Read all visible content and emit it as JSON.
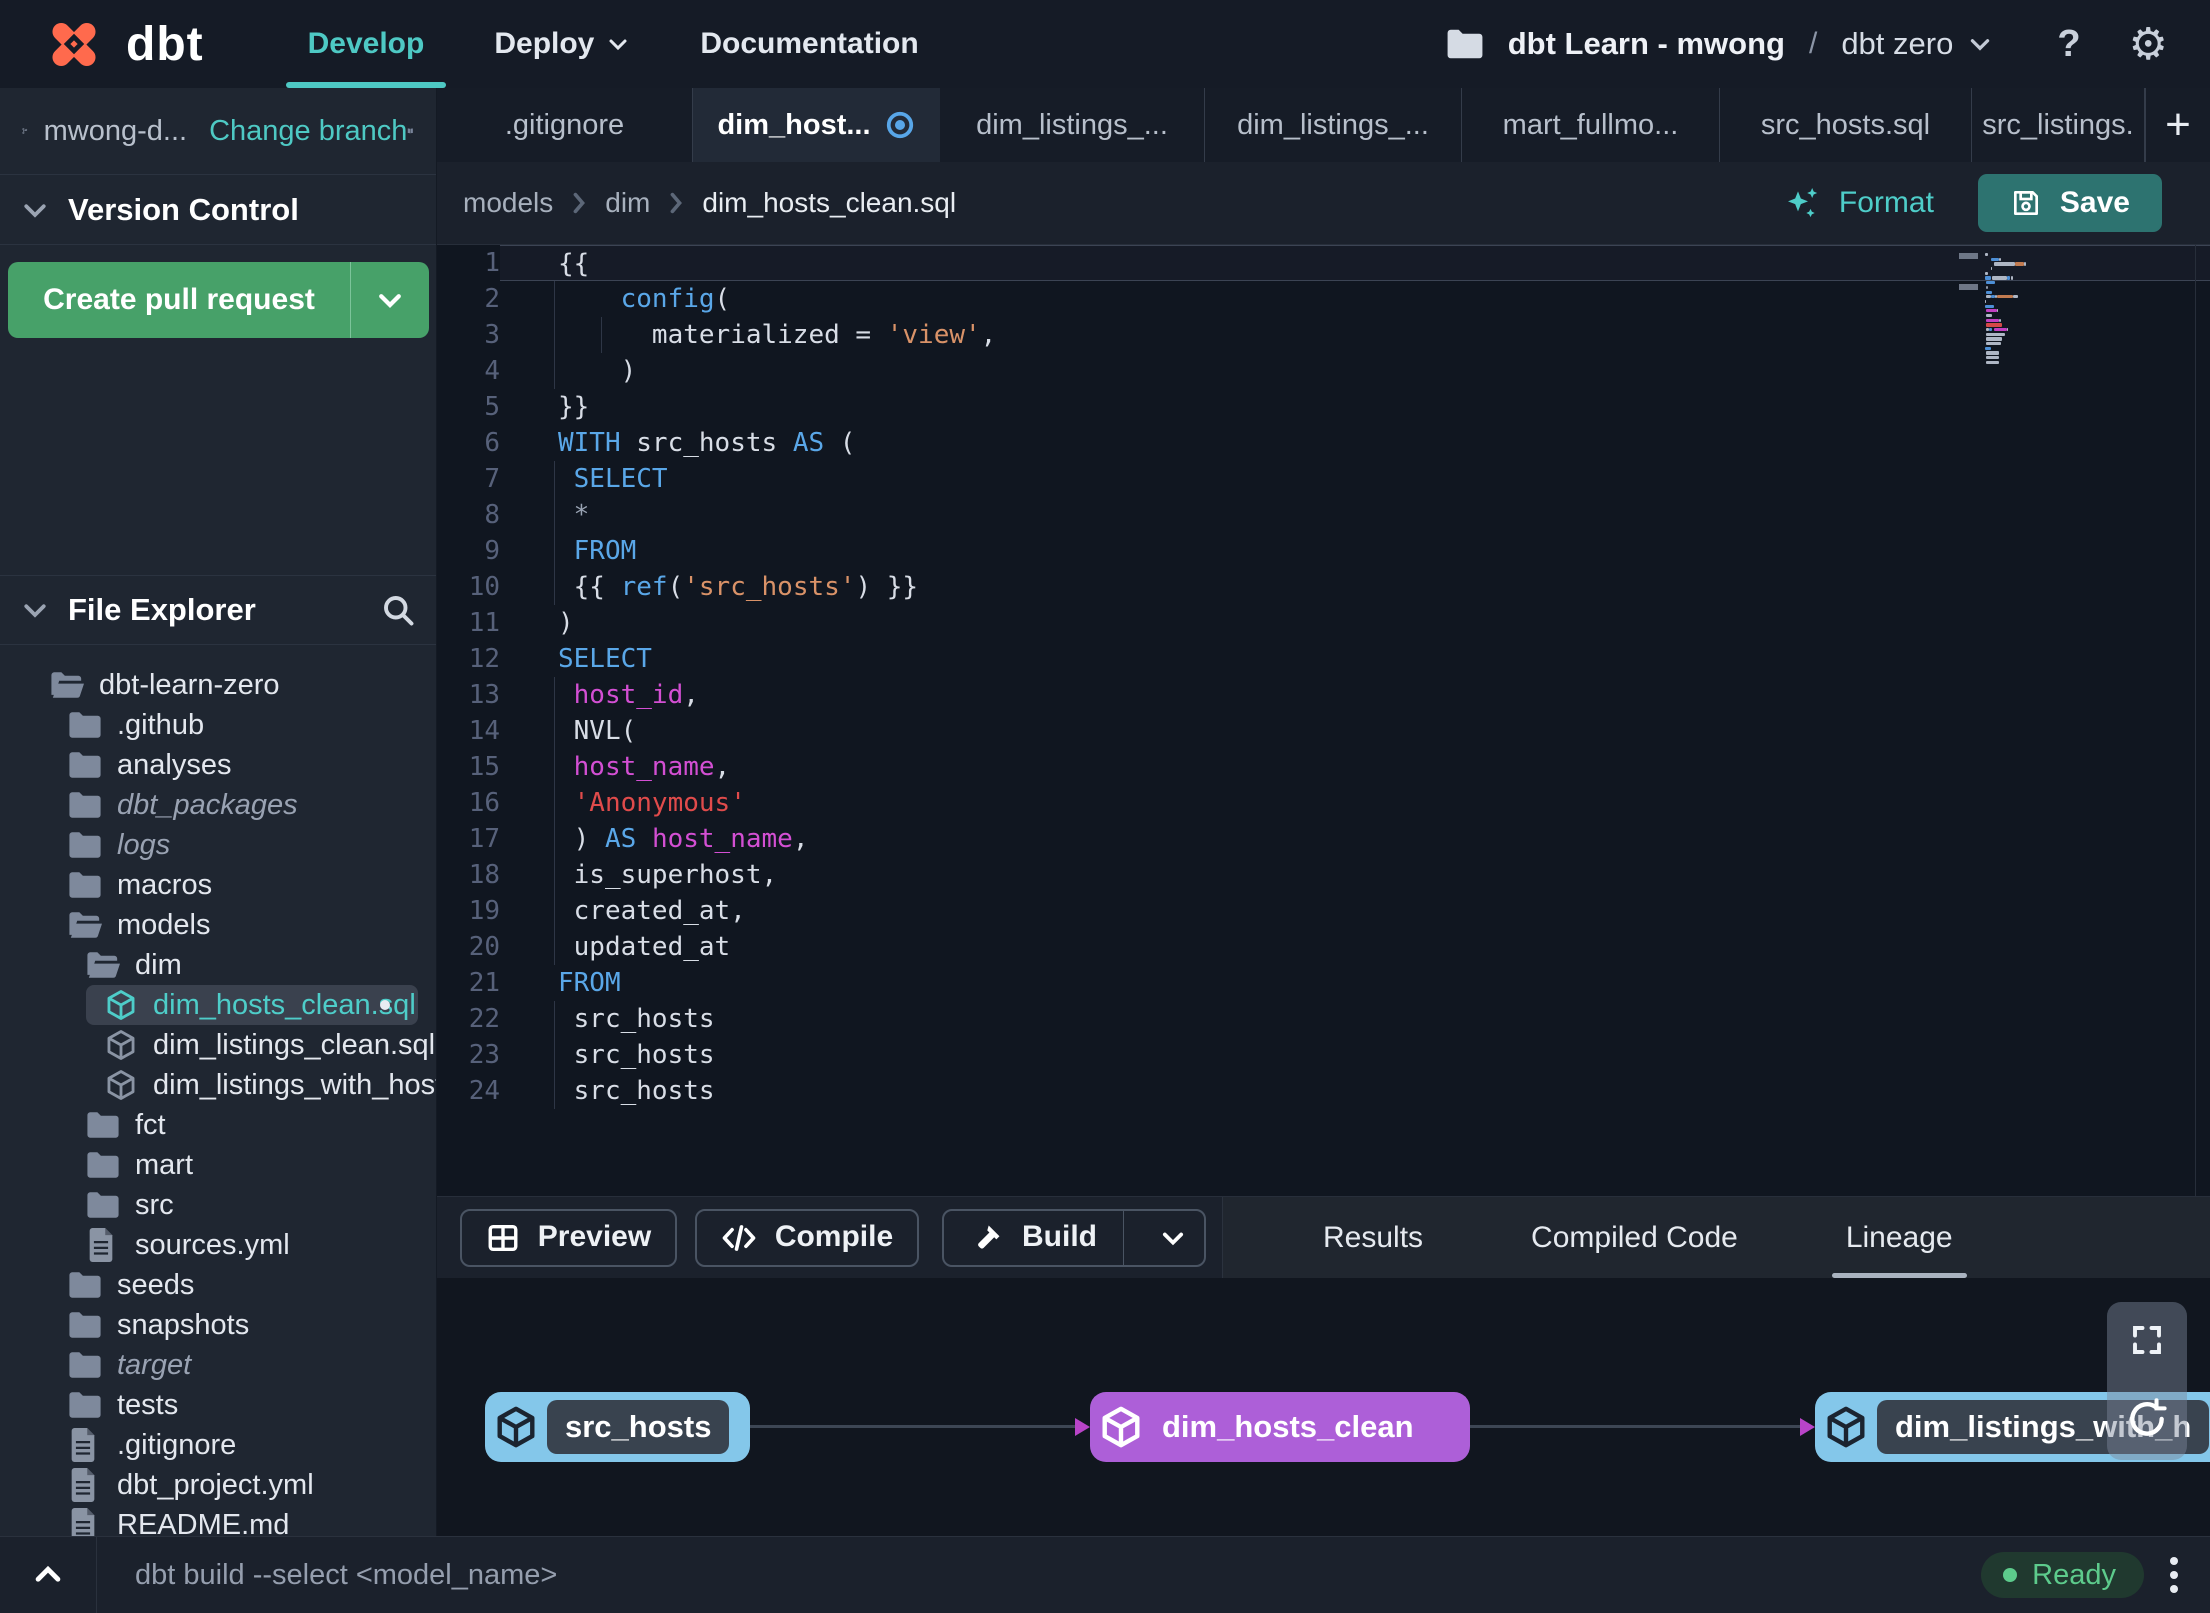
{
  "navbar": {
    "logo_text": "dbt",
    "links": [
      {
        "label": "Develop",
        "active": true,
        "chevron": false
      },
      {
        "label": "Deploy",
        "active": false,
        "chevron": true
      },
      {
        "label": "Documentation",
        "active": false,
        "chevron": false
      }
    ],
    "project_account": "dbt Learn - mwong",
    "project_separator": "/",
    "project_name": "dbt zero",
    "help_label": "?"
  },
  "sidebar": {
    "branch_name": "mwong-d...",
    "change_branch_label": "Change branch",
    "version_control_header": "Version Control",
    "create_pr_label": "Create pull request",
    "file_explorer_header": "File Explorer",
    "tree": [
      {
        "label": "dbt-learn-zero",
        "type": "folder-open",
        "level": 0,
        "muted": false,
        "selected": false
      },
      {
        "label": ".github",
        "type": "folder",
        "level": 1,
        "muted": false,
        "selected": false
      },
      {
        "label": "analyses",
        "type": "folder",
        "level": 1,
        "muted": false,
        "selected": false
      },
      {
        "label": "dbt_packages",
        "type": "folder",
        "level": 1,
        "muted": true,
        "selected": false
      },
      {
        "label": "logs",
        "type": "folder",
        "level": 1,
        "muted": true,
        "selected": false
      },
      {
        "label": "macros",
        "type": "folder",
        "level": 1,
        "muted": false,
        "selected": false
      },
      {
        "label": "models",
        "type": "folder-open",
        "level": 1,
        "muted": false,
        "selected": false
      },
      {
        "label": "dim",
        "type": "folder-open",
        "level": 2,
        "muted": false,
        "selected": false
      },
      {
        "label": "dim_hosts_clean.sql",
        "type": "model",
        "level": 3,
        "muted": false,
        "selected": true
      },
      {
        "label": "dim_listings_clean.sql",
        "type": "model",
        "level": 3,
        "muted": false,
        "selected": false
      },
      {
        "label": "dim_listings_with_hosts...",
        "type": "model",
        "level": 3,
        "muted": false,
        "selected": false
      },
      {
        "label": "fct",
        "type": "folder",
        "level": 2,
        "muted": false,
        "selected": false
      },
      {
        "label": "mart",
        "type": "folder",
        "level": 2,
        "muted": false,
        "selected": false
      },
      {
        "label": "src",
        "type": "folder",
        "level": 2,
        "muted": false,
        "selected": false
      },
      {
        "label": "sources.yml",
        "type": "file",
        "level": 2,
        "muted": false,
        "selected": false
      },
      {
        "label": "seeds",
        "type": "folder",
        "level": 1,
        "muted": false,
        "selected": false
      },
      {
        "label": "snapshots",
        "type": "folder",
        "level": 1,
        "muted": false,
        "selected": false
      },
      {
        "label": "target",
        "type": "folder",
        "level": 1,
        "muted": true,
        "selected": false
      },
      {
        "label": "tests",
        "type": "folder",
        "level": 1,
        "muted": false,
        "selected": false
      },
      {
        "label": ".gitignore",
        "type": "file",
        "level": 1,
        "muted": false,
        "selected": false
      },
      {
        "label": "dbt_project.yml",
        "type": "file",
        "level": 1,
        "muted": false,
        "selected": false
      },
      {
        "label": "README.md",
        "type": "file",
        "level": 1,
        "muted": false,
        "selected": false
      }
    ]
  },
  "tabs": [
    {
      "label": ".gitignore",
      "active": false,
      "modified": false
    },
    {
      "label": "dim_host...",
      "active": true,
      "modified": true
    },
    {
      "label": "dim_listings_...",
      "active": false,
      "modified": false
    },
    {
      "label": "dim_listings_...",
      "active": false,
      "modified": false
    },
    {
      "label": "mart_fullmo...",
      "active": false,
      "modified": false
    },
    {
      "label": "src_hosts.sql",
      "active": false,
      "modified": false
    },
    {
      "label": "src_listings.",
      "active": false,
      "modified": false
    }
  ],
  "breadcrumb": [
    "models",
    "dim",
    "dim_hosts_clean.sql"
  ],
  "editor": {
    "format_label": "Format",
    "save_label": "Save",
    "code": [
      [
        {
          "t": "{{",
          "c": "p"
        }
      ],
      [
        {
          "t": "    ",
          "c": "p"
        },
        {
          "t": "config",
          "c": "kw"
        },
        {
          "t": "(",
          "c": "p"
        }
      ],
      [
        {
          "t": "      ",
          "c": "p"
        },
        {
          "t": "materialized = ",
          "c": "p"
        },
        {
          "t": "'view'",
          "c": "str"
        },
        {
          "t": ",",
          "c": "p"
        }
      ],
      [
        {
          "t": "    )",
          "c": "p"
        }
      ],
      [
        {
          "t": "}}",
          "c": "p"
        }
      ],
      [
        {
          "t": "WITH",
          "c": "kw"
        },
        {
          "t": " src_hosts ",
          "c": "p"
        },
        {
          "t": "AS",
          "c": "kw"
        },
        {
          "t": " (",
          "c": "p"
        }
      ],
      [
        {
          "t": " ",
          "c": "p"
        },
        {
          "t": "SELECT",
          "c": "kw"
        }
      ],
      [
        {
          "t": " ",
          "c": "p"
        },
        {
          "t": "*",
          "c": "star"
        }
      ],
      [
        {
          "t": " ",
          "c": "p"
        },
        {
          "t": "FROM",
          "c": "kw"
        }
      ],
      [
        {
          "t": " {{ ",
          "c": "p"
        },
        {
          "t": "ref",
          "c": "kw"
        },
        {
          "t": "(",
          "c": "p"
        },
        {
          "t": "'src_hosts'",
          "c": "str"
        },
        {
          "t": ") }}",
          "c": "p"
        }
      ],
      [
        {
          "t": ")",
          "c": "p"
        }
      ],
      [
        {
          "t": "SELECT",
          "c": "kw"
        }
      ],
      [
        {
          "t": " ",
          "c": "p"
        },
        {
          "t": "host_id",
          "c": "field"
        },
        {
          "t": ",",
          "c": "p"
        }
      ],
      [
        {
          "t": " NVL(",
          "c": "p"
        }
      ],
      [
        {
          "t": " ",
          "c": "p"
        },
        {
          "t": "host_name",
          "c": "field"
        },
        {
          "t": ",",
          "c": "p"
        }
      ],
      [
        {
          "t": " ",
          "c": "p"
        },
        {
          "t": "'Anonymous'",
          "c": "str2"
        }
      ],
      [
        {
          "t": " ) ",
          "c": "p"
        },
        {
          "t": "AS",
          "c": "kw"
        },
        {
          "t": " ",
          "c": "p"
        },
        {
          "t": "host_name",
          "c": "field"
        },
        {
          "t": ",",
          "c": "p"
        }
      ],
      [
        {
          "t": " is_superhost,",
          "c": "p"
        }
      ],
      [
        {
          "t": " created_at,",
          "c": "p"
        }
      ],
      [
        {
          "t": " updated_at",
          "c": "p"
        }
      ],
      [
        {
          "t": "FROM",
          "c": "kw"
        }
      ],
      [
        {
          "t": " src_hosts",
          "c": "p"
        }
      ],
      [
        {
          "t": " src_hosts",
          "c": "p"
        }
      ],
      [
        {
          "t": " src_hosts",
          "c": "p"
        }
      ]
    ]
  },
  "panel": {
    "preview_label": "Preview",
    "compile_label": "Compile",
    "build_label": "Build",
    "tabs": [
      {
        "label": "Results",
        "active": false
      },
      {
        "label": "Compiled Code",
        "active": false
      },
      {
        "label": "Lineage",
        "active": true
      }
    ]
  },
  "lineage": {
    "nodes": [
      {
        "label": "src_hosts",
        "variant": "source"
      },
      {
        "label": "dim_hosts_clean",
        "variant": "selected"
      },
      {
        "label": "dim_listings_with_h",
        "variant": "source"
      }
    ]
  },
  "footer": {
    "command_placeholder": "dbt build --select <model_name>",
    "status_label": "Ready"
  },
  "colors": {
    "accent_teal": "#4ec9c4",
    "pr_green": "#47a169",
    "node_blue": "#84c7ea",
    "node_purple": "#ad5fd8",
    "edge_arrow_purple": "#b944c8",
    "modified_blue": "#58a6e8",
    "status_green": "#5dcb8c",
    "logo_orange": "#ff6a4d",
    "code_keyword": "#5aa7e8",
    "code_string": "#d99268",
    "code_string_red": "#e04b4b",
    "code_field": "#d34fd3"
  }
}
